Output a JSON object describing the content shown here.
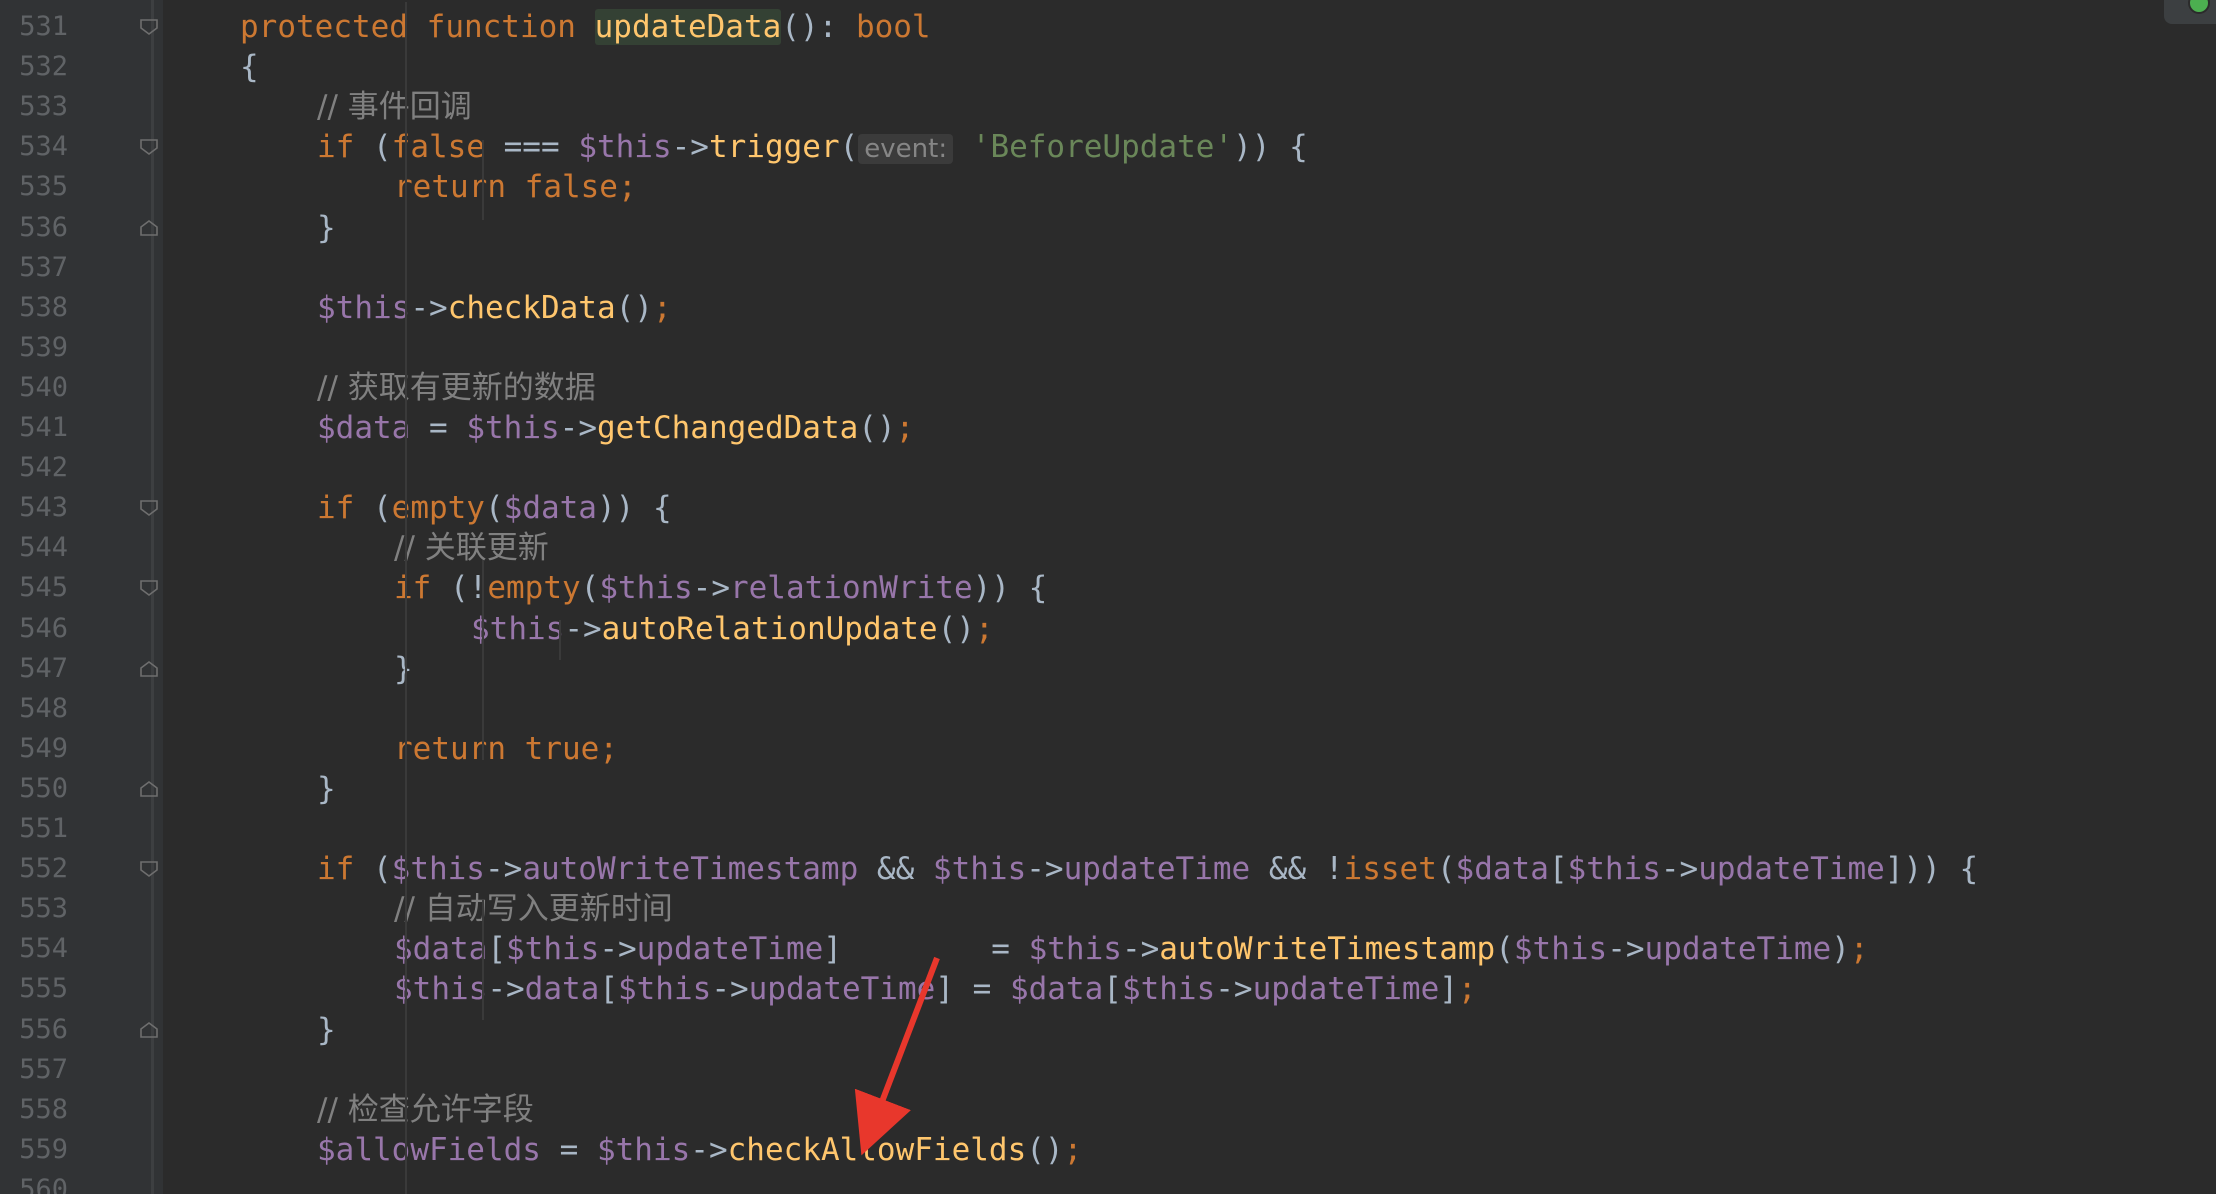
{
  "editor": {
    "lines": [
      {
        "n": "531"
      },
      {
        "n": "532"
      },
      {
        "n": "533"
      },
      {
        "n": "534"
      },
      {
        "n": "535"
      },
      {
        "n": "536"
      },
      {
        "n": "537"
      },
      {
        "n": "538"
      },
      {
        "n": "539"
      },
      {
        "n": "540"
      },
      {
        "n": "541"
      },
      {
        "n": "542"
      },
      {
        "n": "543"
      },
      {
        "n": "544"
      },
      {
        "n": "545"
      },
      {
        "n": "546"
      },
      {
        "n": "547"
      },
      {
        "n": "548"
      },
      {
        "n": "549"
      },
      {
        "n": "550"
      },
      {
        "n": "551"
      },
      {
        "n": "552"
      },
      {
        "n": "553"
      },
      {
        "n": "554"
      },
      {
        "n": "555"
      },
      {
        "n": "556"
      },
      {
        "n": "557"
      },
      {
        "n": "558"
      },
      {
        "n": "559"
      },
      {
        "n": "560"
      }
    ],
    "tokens": {
      "l531": [
        "protected",
        " ",
        "function",
        " ",
        "updateData",
        "(): ",
        "bool"
      ],
      "l532": [
        "{"
      ],
      "l533": [
        "// 事件回调"
      ],
      "l534": [
        "if",
        " (",
        "false",
        " === ",
        "$this",
        "->",
        "trigger",
        "(",
        "event:",
        " ",
        "'BeforeUpdate'",
        ")) {"
      ],
      "l535": [
        "return",
        " ",
        "false",
        ";"
      ],
      "l536": [
        "}"
      ],
      "l538": [
        "$this",
        "->",
        "checkData",
        "()",
        ";"
      ],
      "l540": [
        "// 获取有更新的数据"
      ],
      "l541": [
        "$data",
        " = ",
        "$this",
        "->",
        "getChangedData",
        "()",
        ";"
      ],
      "l543": [
        "if",
        " (",
        "empty",
        "(",
        "$data",
        ")) {"
      ],
      "l544": [
        "// 关联更新"
      ],
      "l545": [
        "if",
        " (!",
        "empty",
        "(",
        "$this",
        "->",
        "relationWrite",
        ")) {"
      ],
      "l546": [
        "$this",
        "->",
        "autoRelationUpdate",
        "()",
        ";"
      ],
      "l547": [
        "}"
      ],
      "l549": [
        "return",
        " ",
        "true",
        ";"
      ],
      "l550": [
        "}"
      ],
      "l552": [
        "if",
        " (",
        "$this",
        "->",
        "autoWriteTimestamp",
        " && ",
        "$this",
        "->",
        "updateTime",
        " && ",
        "!",
        "isset",
        "(",
        "$data",
        "[",
        "$this",
        "->",
        "updateTime",
        "])) {"
      ],
      "l553": [
        "// 自动写入更新时间"
      ],
      "l554": [
        "$data",
        "[",
        "$this",
        "->",
        "updateTime",
        "]        = ",
        "$this",
        "->",
        "autoWriteTimestamp",
        "(",
        "$this",
        "->",
        "updateTime",
        ")",
        ";"
      ],
      "l555": [
        "$this",
        "->",
        "data",
        "[",
        "$this",
        "->",
        "updateTime",
        "] = ",
        "$data",
        "[",
        "$this",
        "->",
        "updateTime",
        "]",
        ";"
      ],
      "l556": [
        "}"
      ],
      "l558": [
        "// 检查允许字段"
      ],
      "l559": [
        "$allowFields",
        " = ",
        "$this",
        "->",
        "checkAllowFields",
        "()",
        ";"
      ]
    }
  },
  "colors": {
    "background": "#2b2b2b",
    "gutter": "#313335",
    "keyword": "#cc7832",
    "function": "#ffc66d",
    "variable": "#9876aa",
    "string": "#6a8759",
    "comment": "#808080",
    "annotation_arrow": "#e8372c"
  },
  "icons": {
    "fold_open": "fold-open-icon",
    "fold_close": "fold-close-icon"
  }
}
